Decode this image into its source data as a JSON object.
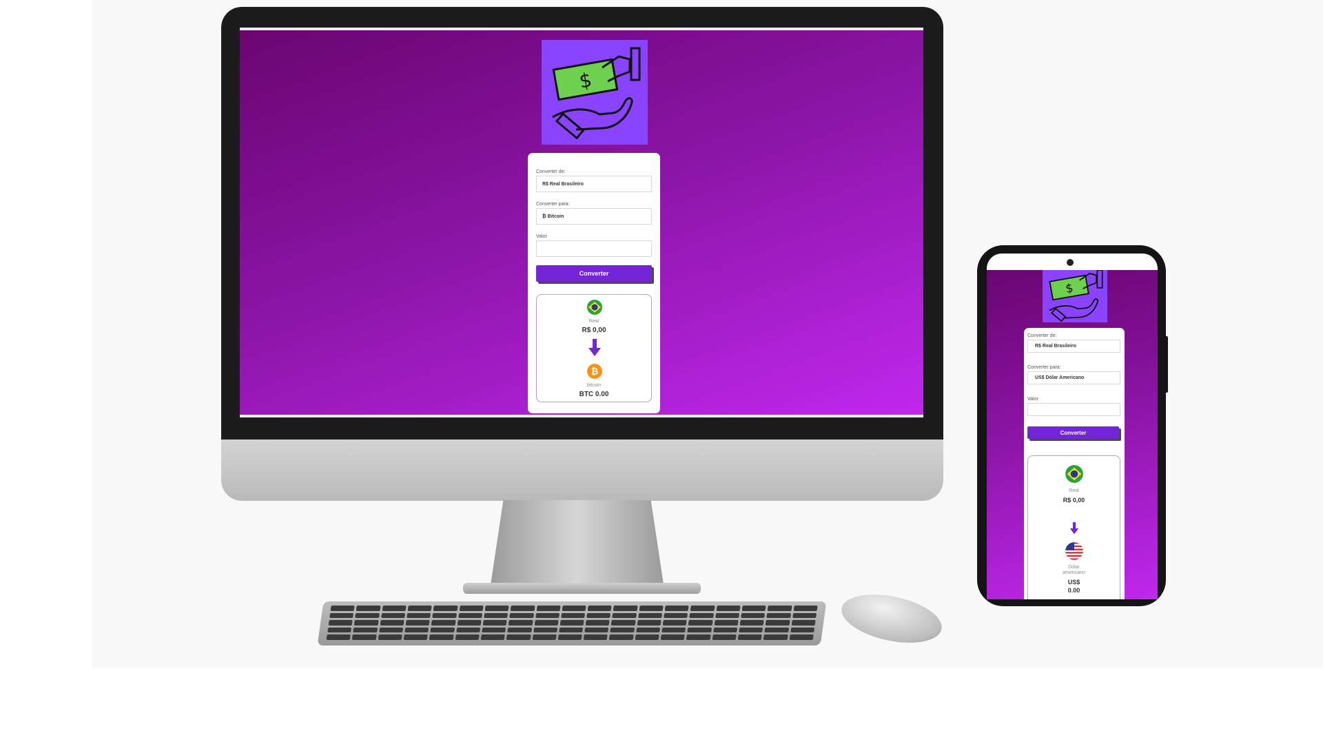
{
  "colors": {
    "primary": "#7426d6",
    "logo_bg": "#8a44ff",
    "gradient_start": "#6a0671",
    "gradient_end": "#c028ee",
    "bill_green": "#6fd04f",
    "bitcoin_orange": "#f7931a"
  },
  "icons": [
    "hand-money-logo-icon",
    "brazil-flag-icon",
    "arrow-down-icon",
    "bitcoin-icon",
    "usa-flag-icon"
  ],
  "desktop": {
    "from_label": "Converter de:",
    "from_value": "R$ Real Brasileiro",
    "to_label": "Converter para:",
    "to_value": "₿ Bitcoin",
    "amount_label": "Valor",
    "amount_value": "",
    "button_label": "Converter",
    "result": {
      "from_name": "Real",
      "from_value": "R$ 0,00",
      "to_name": "bitcoin",
      "to_value": "BTC 0.00"
    }
  },
  "mobile": {
    "from_label": "Converter de:",
    "from_value": "R$ Real Brasileiro",
    "to_label": "Converter para:",
    "to_value": "US$ Dólar Americano",
    "amount_label": "Valor",
    "amount_value": "",
    "button_label": "Converter",
    "result": {
      "from_name": "Real",
      "from_value": "R$ 0,00",
      "to_name": "Dólar americano",
      "to_value": "US$ 0.00"
    }
  }
}
